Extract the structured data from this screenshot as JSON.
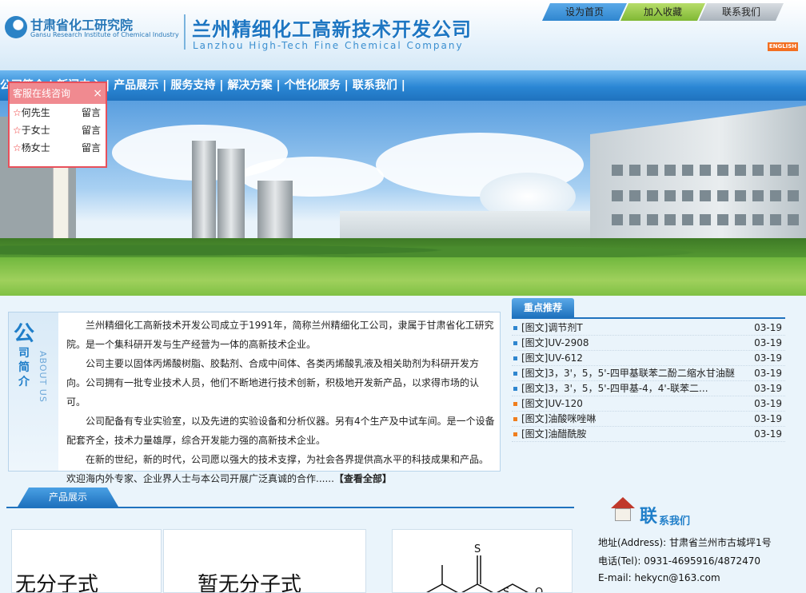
{
  "header": {
    "org_cn": "甘肃省化工研究院",
    "org_en": "Gansu Research Institute of Chemical Industry",
    "company_cn": "兰州精细化工高新技术开发公司",
    "company_en": "Lanzhou High-Tech Fine Chemical Company",
    "top_links": [
      "设为首页",
      "加入收藏",
      "联系我们"
    ],
    "english_label": "ENGLISH"
  },
  "nav": {
    "items": [
      "公司简介",
      "新闻中心",
      "产品展示",
      "服务支持",
      "解决方案",
      "个性化服务",
      "联系我们"
    ],
    "separator": "|"
  },
  "consult": {
    "title": "客服在线咨询",
    "close": "×",
    "star": "☆",
    "message_label": "留言",
    "contacts": [
      "何先生",
      "于女士",
      "杨女士"
    ]
  },
  "about": {
    "title_big": "公",
    "title_rest": [
      "司",
      "简",
      "介"
    ],
    "title_en": "ABOUT US",
    "paragraphs": [
      "兰州精细化工高新技术开发公司成立于1991年，简称兰州精细化工公司，隶属于甘肃省化工研究院。是一个集科研开发与生产经营为一体的高新技术企业。",
      "公司主要以固体丙烯酸树脂、胶黏剂、合成中间体、各类丙烯酸乳液及相关助剂为科研开发方向。公司拥有一批专业技术人员，他们不断地进行技术创新，积极地开发新产品，以求得市场的认可。",
      "公司配备有专业实验室，以及先进的实验设备和分析仪器。另有4个生产及中试车间。是一个设备配套齐全，技术力量雄厚，综合开发能力强的高新技术企业。",
      "在新的世纪，新的时代，公司愿以强大的技术支撑，为社会各界提供高水平的科技成果和产品。欢迎海内外专家、企业界人士与本公司开展广泛真诚的合作......"
    ],
    "more_label": "【查看全部】"
  },
  "featured": {
    "tab_label": "重点推荐",
    "items": [
      {
        "title": "[图文]调节剂T",
        "date": "03-19",
        "dot": "blue"
      },
      {
        "title": "[图文]UV-2908",
        "date": "03-19",
        "dot": "blue"
      },
      {
        "title": "[图文]UV-612",
        "date": "03-19",
        "dot": "blue"
      },
      {
        "title": "[图文]3，3'，5，5'-四甲基联苯二酚二缩水甘油醚",
        "date": "03-19",
        "dot": "blue"
      },
      {
        "title": "[图文]3，3'，5，5'-四甲基-4，4'-联苯二...",
        "date": "03-19",
        "dot": "blue"
      },
      {
        "title": "[图文]UV-120",
        "date": "03-19",
        "dot": "orange"
      },
      {
        "title": "[图文]油酸咪唑啉",
        "date": "03-19",
        "dot": "orange"
      },
      {
        "title": "[图文]油醋酰胺",
        "date": "03-19",
        "dot": "orange"
      }
    ]
  },
  "products": {
    "tab_label": "产品展示",
    "cards": [
      "无分子式",
      "暂无分子式"
    ],
    "structure_labels": [
      "S",
      "S",
      "O"
    ]
  },
  "contact": {
    "title_big": "联",
    "title_small": "系我们",
    "address": "地址(Address): 甘肃省兰州市古城坪1号",
    "tel": "电话(Tel): 0931-4695916/4872470",
    "email": "E-mail: hekycn@163.com"
  },
  "colors": {
    "primary_blue": "#1f72be",
    "accent_orange": "#f36f21",
    "consult_red": "#e8505b"
  }
}
